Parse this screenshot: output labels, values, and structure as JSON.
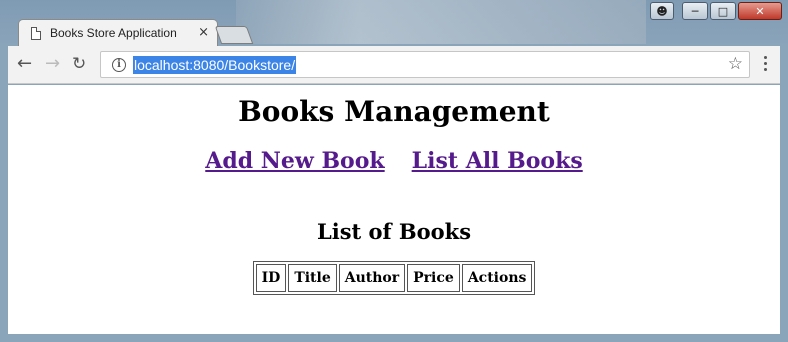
{
  "browser": {
    "tab_title": "Books Store Application",
    "tab_close": "×",
    "url": "localhost:8080/Bookstore/",
    "info_symbol": "i",
    "icons": {
      "back": "arrow-left",
      "forward": "arrow-right",
      "reload": "reload",
      "star": "star",
      "menu": "three-dots"
    },
    "window_buttons": {
      "user": "user-icon",
      "minimize": "minimize",
      "maximize": "maximize",
      "close": "close"
    }
  },
  "page": {
    "title": "Books Management",
    "links": {
      "add": "Add New Book",
      "list": "List All Books"
    },
    "table": {
      "caption": "List of Books",
      "headers": [
        "ID",
        "Title",
        "Author",
        "Price",
        "Actions"
      ],
      "rows": []
    },
    "colors": {
      "link": "#551a8b",
      "url_highlight": "#3c84e6"
    }
  }
}
